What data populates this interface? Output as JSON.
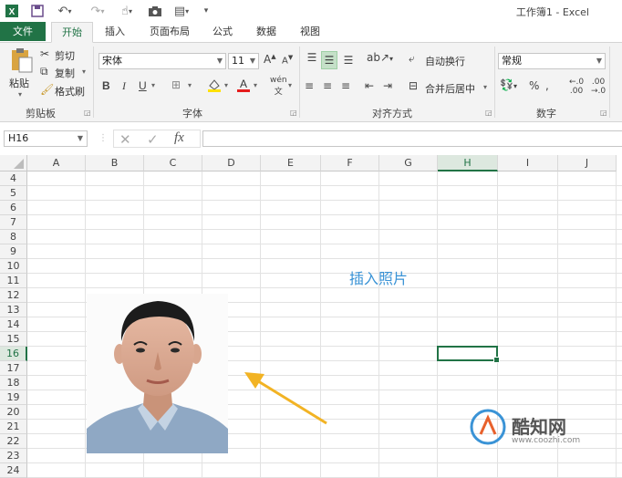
{
  "window": {
    "title": "工作簿1 - Excel"
  },
  "tabs": [
    "文件",
    "开始",
    "插入",
    "页面布局",
    "公式",
    "数据",
    "视图"
  ],
  "ribbon": {
    "clipboard": {
      "label": "剪贴板",
      "paste": "粘贴",
      "cut": "剪切",
      "copy": "复制",
      "format_painter": "格式刷"
    },
    "font": {
      "label": "字体",
      "name": "宋体",
      "size": "11",
      "bold": "B",
      "italic": "I",
      "underline": "U"
    },
    "alignment": {
      "label": "对齐方式",
      "wrap": "自动换行",
      "merge": "合并后居中"
    },
    "number": {
      "label": "数字",
      "format": "常规",
      "percent": "%"
    }
  },
  "formula_bar": {
    "name_box": "H16",
    "fx": "fx",
    "formula": ""
  },
  "grid": {
    "columns": [
      "A",
      "B",
      "C",
      "D",
      "E",
      "F",
      "G",
      "H",
      "I",
      "J"
    ],
    "rows": [
      "4",
      "5",
      "6",
      "7",
      "8",
      "9",
      "10",
      "11",
      "12",
      "13",
      "14",
      "15",
      "16",
      "17",
      "18",
      "19",
      "20",
      "21",
      "22",
      "23",
      "24"
    ],
    "selected_column": "H",
    "selected_row": "16"
  },
  "annotation": "插入照片",
  "watermark": {
    "brand": "酷知网",
    "url": "www.coozhi.com"
  },
  "colors": {
    "excel_green": "#217346",
    "annotation_blue": "#3a93d6",
    "arrow_yellow": "#f2b324"
  }
}
